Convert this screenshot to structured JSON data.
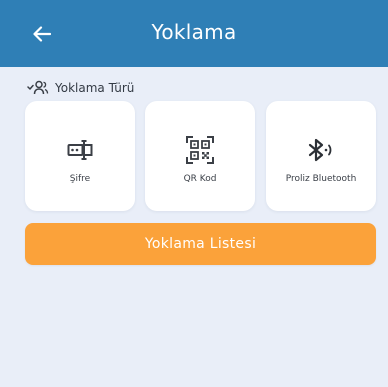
{
  "header": {
    "title": "Yoklama",
    "back_icon": "arrow-left-icon",
    "background": "#2f7fb6"
  },
  "section": {
    "label": "Yoklama Türü",
    "icon": "people-check-icon"
  },
  "options": [
    {
      "label": "Şifre",
      "icon": "password-field-icon"
    },
    {
      "label": "QR Kod",
      "icon": "qr-code-icon"
    },
    {
      "label": "Proliz Bluetooth",
      "icon": "bluetooth-icon"
    }
  ],
  "actions": {
    "list_button_label": "Yoklama Listesi",
    "list_button_color": "#fba23a"
  }
}
